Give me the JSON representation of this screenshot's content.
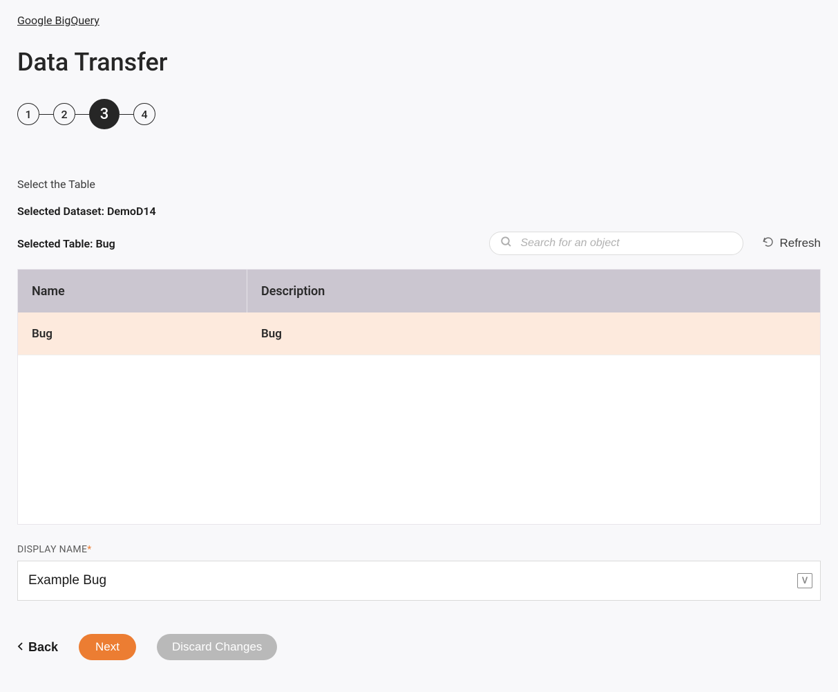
{
  "breadcrumb": "Google BigQuery",
  "page_title": "Data Transfer",
  "steps": [
    "1",
    "2",
    "3",
    "4"
  ],
  "active_step_index": 2,
  "section_label": "Select the Table",
  "selected_dataset_label": "Selected Dataset: DemoD14",
  "selected_table_label": "Selected Table: Bug",
  "search": {
    "placeholder": "Search for an object"
  },
  "refresh_label": "Refresh",
  "table": {
    "columns": {
      "name": "Name",
      "description": "Description"
    },
    "rows": [
      {
        "name": "Bug",
        "description": "Bug",
        "selected": true
      }
    ]
  },
  "display_name": {
    "label": "DISPLAY NAME",
    "value": "Example Bug",
    "suffix_icon": "V"
  },
  "actions": {
    "back": "Back",
    "next": "Next",
    "discard": "Discard Changes"
  }
}
